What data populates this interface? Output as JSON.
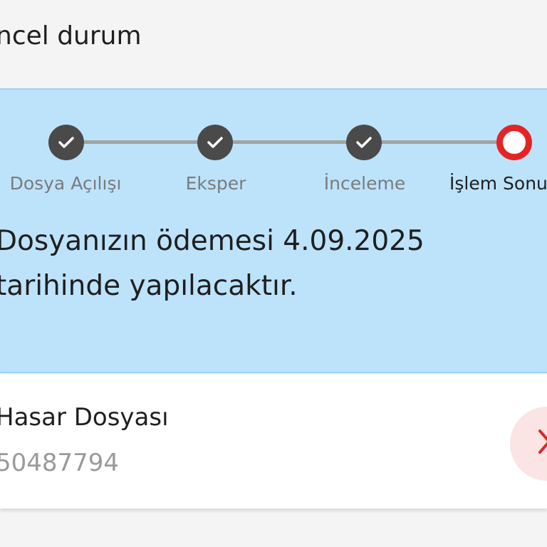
{
  "header": {
    "title": "ncel durum"
  },
  "stepper": {
    "steps": [
      {
        "label": "Dosya Açılışı",
        "state": "done"
      },
      {
        "label": "Eksper",
        "state": "done"
      },
      {
        "label": "İnceleme",
        "state": "done"
      },
      {
        "label": "İşlem Sonu",
        "state": "current"
      }
    ],
    "colors": {
      "done": "#4a4a4a",
      "current": "#e42424",
      "line": "#a3a3a3"
    }
  },
  "status": {
    "message": "Dosyanızın ödemesi 4.09.2025 tarihinde yapılacaktır."
  },
  "claim": {
    "type": "Hasar Dosyası",
    "number": "50487794",
    "action_icon": "close-icon"
  },
  "colors": {
    "panel_background": "#bde3fb",
    "accent_red": "#e42424"
  }
}
